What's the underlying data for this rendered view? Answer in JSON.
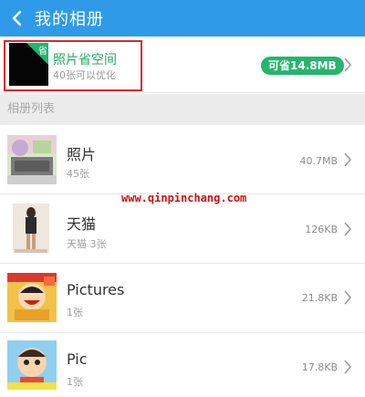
{
  "header": {
    "title": "我的相册",
    "back_icon": "back-chevron-icon"
  },
  "optimize": {
    "title": "照片省空间",
    "subtitle": "40张可以优化",
    "corner_label": "省",
    "save_badge": "可省14.8MB",
    "accent": "#25b56c"
  },
  "section": {
    "label": "相册列表"
  },
  "albums": [
    {
      "name": "照片",
      "count": "45张",
      "size": "40.7MB"
    },
    {
      "name": "天猫",
      "count": "天猫 3张",
      "size": "126KB"
    },
    {
      "name": "Pictures",
      "count": "1张",
      "size": "21.8KB"
    },
    {
      "name": "Pic",
      "count": "1张",
      "size": "17.8KB"
    }
  ],
  "watermark": "www.qinpinchang.com",
  "colors": {
    "header": "#2f9be8",
    "highlight_border": "#e0242a",
    "watermark": "#d01010"
  }
}
